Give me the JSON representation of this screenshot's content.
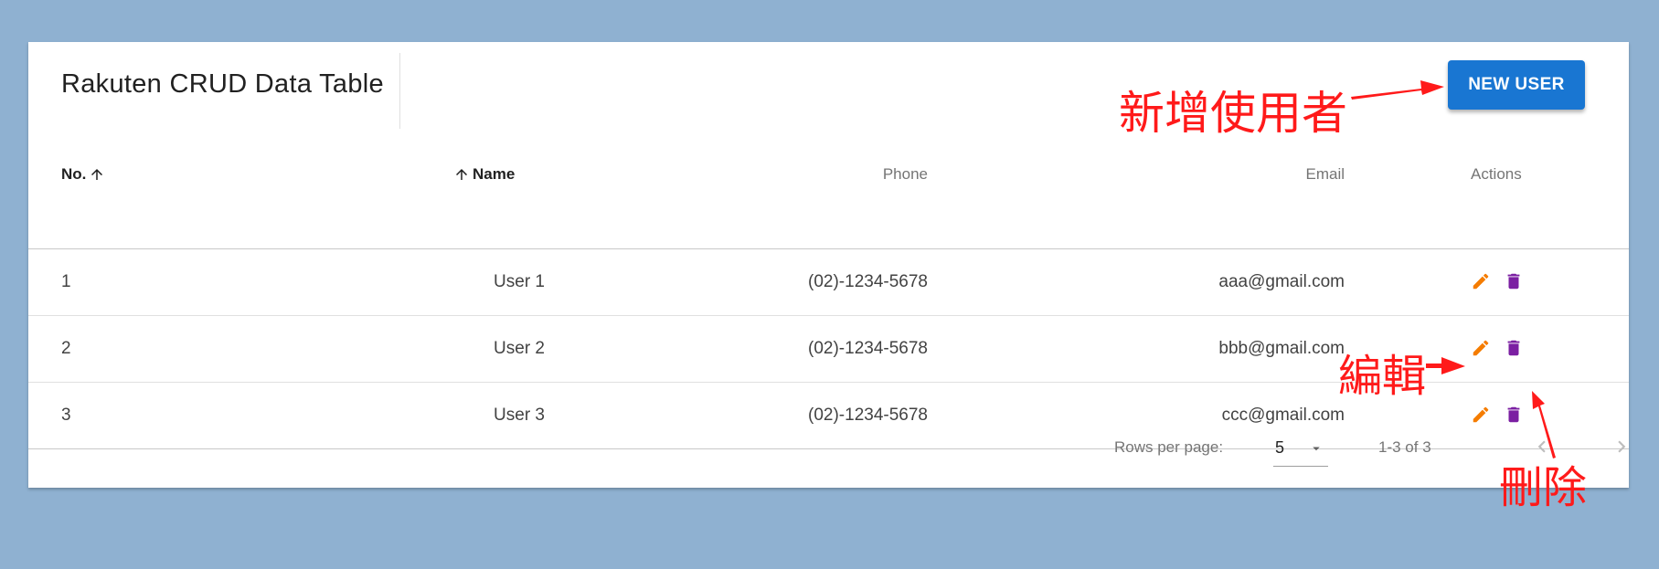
{
  "app": {
    "title": "Rakuten CRUD Data Table",
    "new_user_label": "NEW USER"
  },
  "table": {
    "headers": {
      "no": "No.",
      "name": "Name",
      "phone": "Phone",
      "email": "Email",
      "actions": "Actions"
    },
    "rows": [
      {
        "no": "1",
        "name": "User 1",
        "phone": "(02)-1234-5678",
        "email": "aaa@gmail.com"
      },
      {
        "no": "2",
        "name": "User 2",
        "phone": "(02)-1234-5678",
        "email": "bbb@gmail.com"
      },
      {
        "no": "3",
        "name": "User 3",
        "phone": "(02)-1234-5678",
        "email": "ccc@gmail.com"
      }
    ]
  },
  "footer": {
    "rows_per_page_label": "Rows per page:",
    "rows_per_page_value": "5",
    "page_info": "1-3 of 3"
  },
  "icons": {
    "sort": "arrow-up-icon",
    "edit": "pencil-icon",
    "delete": "trash-icon",
    "caret": "caret-down-icon",
    "prev": "chevron-left-icon",
    "next": "chevron-right-icon"
  },
  "annotations": {
    "new_user": "新增使用者",
    "edit": "編輯",
    "delete": "刪除"
  },
  "colors": {
    "background": "#8fb1d1",
    "primary": "#1976d2",
    "edit": "#f57c00",
    "delete": "#7b1fa2",
    "annotation": "#ff1a1a"
  }
}
